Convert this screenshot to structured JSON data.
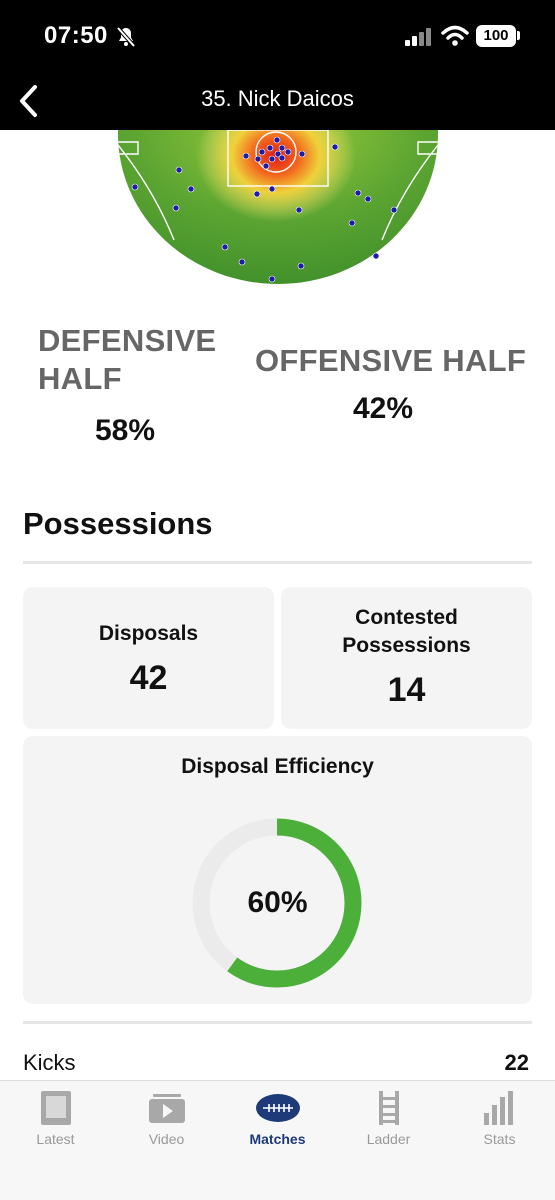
{
  "status_bar": {
    "time": "07:50",
    "battery": "100"
  },
  "nav": {
    "title": "35. Nick Daicos"
  },
  "halves": {
    "defensive_label": "DEFENSIVE HALF",
    "defensive_value": "58%",
    "offensive_label": "OFFENSIVE HALF",
    "offensive_value": "42%"
  },
  "possessions": {
    "title": "Possessions",
    "disposals_label": "Disposals",
    "disposals_value": "42",
    "contested_label": "Contested Possessions",
    "contested_value": "14",
    "efficiency_label": "Disposal Efficiency",
    "efficiency_value": "60%",
    "efficiency_fraction": 0.6
  },
  "stats": [
    {
      "label": "Kicks",
      "value": "22"
    }
  ],
  "tabs": [
    {
      "label": "Latest",
      "icon": "newspaper-icon"
    },
    {
      "label": "Video",
      "icon": "video-icon"
    },
    {
      "label": "Matches",
      "icon": "football-icon",
      "active": true
    },
    {
      "label": "Ladder",
      "icon": "ladder-icon"
    },
    {
      "label": "Stats",
      "icon": "bar-chart-icon"
    }
  ],
  "colors": {
    "accent": "#1e3a78",
    "efficiency_arc": "#4caf3a",
    "field_green": "#4fa02e",
    "heat_red": "#e8201a",
    "dot": "#1c1ca8"
  }
}
